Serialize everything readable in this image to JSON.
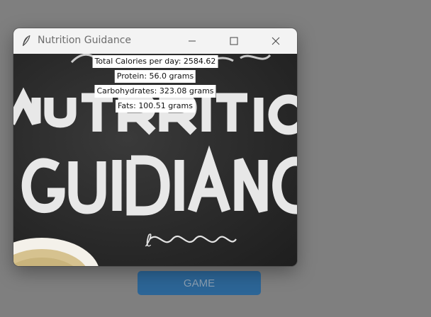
{
  "window": {
    "title": "Nutrition Guidance"
  },
  "labels": {
    "calories": "Total Calories per day: 2584.62",
    "protein": "Protein: 56.0 grams",
    "carbohydrates": "Carbohydrates: 323.08 grams",
    "fats": "Fats: 100.51 grams"
  },
  "background_button": {
    "label": "GAME",
    "color": "#2c6596"
  },
  "icons": {
    "app": "feather-icon",
    "minimize": "minimize-icon",
    "maximize": "maximize-icon",
    "close": "close-icon"
  }
}
